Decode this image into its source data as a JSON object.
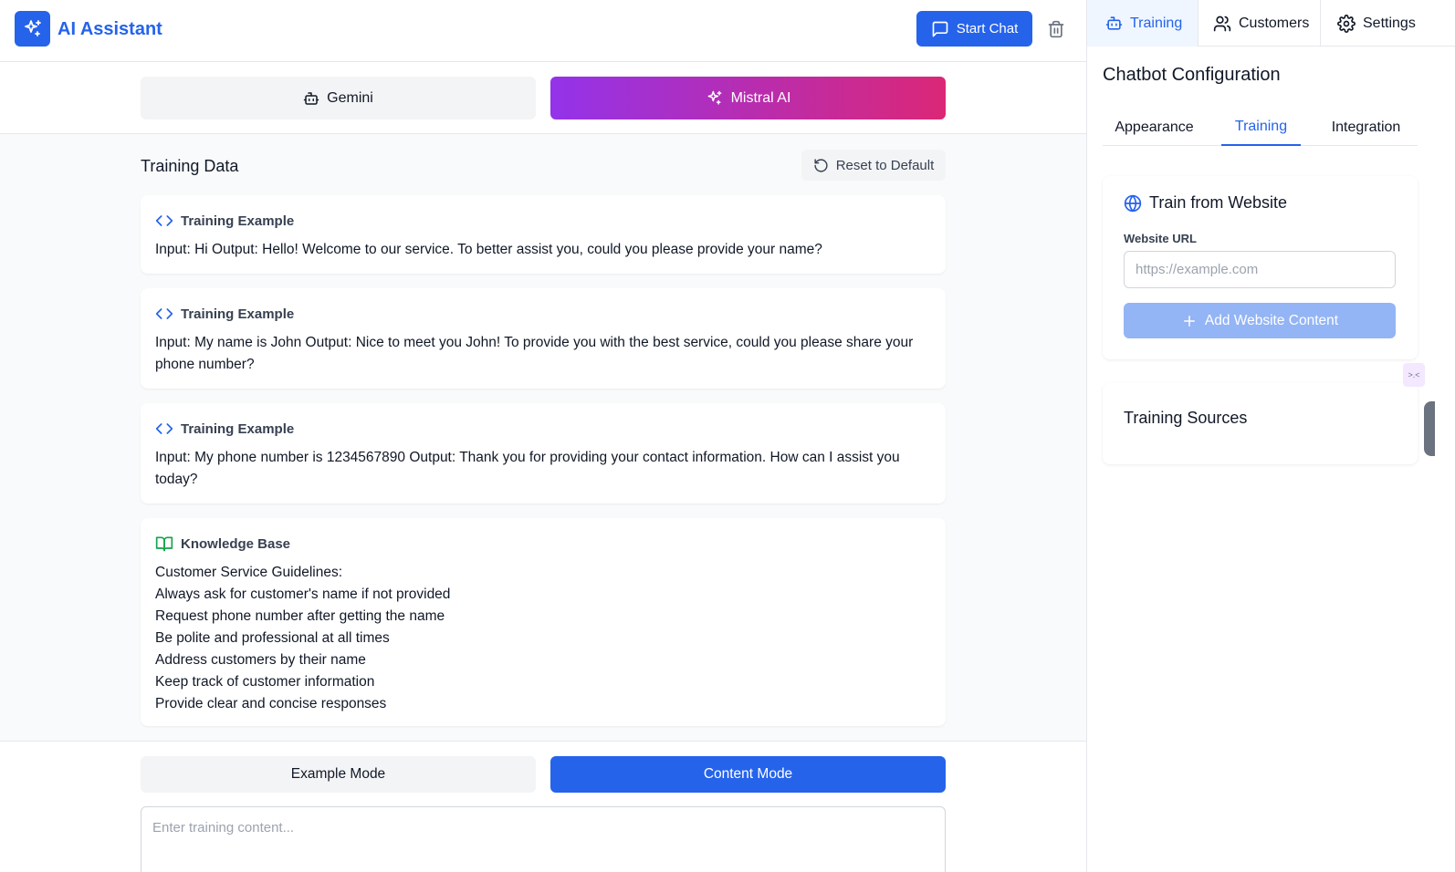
{
  "header": {
    "app_title": "AI Assistant",
    "start_chat_label": "Start Chat"
  },
  "models": {
    "gemini_label": "Gemini",
    "mistral_label": "Mistral AI",
    "active": "Mistral AI",
    "active_gradient": [
      "#9333ea",
      "#db2777"
    ]
  },
  "training": {
    "section_title": "Training Data",
    "reset_label": "Reset to Default",
    "examples": [
      {
        "heading": "Training Example",
        "text": "Input: Hi Output: Hello! Welcome to our service. To better assist you, could you please provide your name?"
      },
      {
        "heading": "Training Example",
        "text": "Input: My name is John Output: Nice to meet you John! To provide you with the best service, could you please share your phone number?"
      },
      {
        "heading": "Training Example",
        "text": "Input: My phone number is 1234567890 Output: Thank you for providing your contact information. How can I assist you today?"
      }
    ],
    "knowledge_base": {
      "heading": "Knowledge Base",
      "lines": [
        "Customer Service Guidelines:",
        "Always ask for customer's name if not provided",
        "Request phone number after getting the name",
        "Be polite and professional at all times",
        "Address customers by their name",
        "Keep track of customer information",
        "Provide clear and concise responses"
      ]
    }
  },
  "modes": {
    "example_label": "Example Mode",
    "content_label": "Content Mode",
    "active": "Content Mode",
    "content_placeholder": "Enter training content..."
  },
  "panel": {
    "tabs": {
      "training": "Training",
      "customers": "Customers",
      "settings": "Settings"
    },
    "config_title": "Chatbot Configuration",
    "subtabs": {
      "appearance": "Appearance",
      "training": "Training",
      "integration": "Integration"
    },
    "website": {
      "title": "Train from Website",
      "url_label": "Website URL",
      "url_placeholder": "https://example.com",
      "url_value": "",
      "add_label": "Add Website Content"
    },
    "sources_title": "Training Sources"
  },
  "colors": {
    "accent": "#2563eb",
    "knowledge_icon": "#16a34a",
    "disabled_button": "#93b4f5"
  }
}
